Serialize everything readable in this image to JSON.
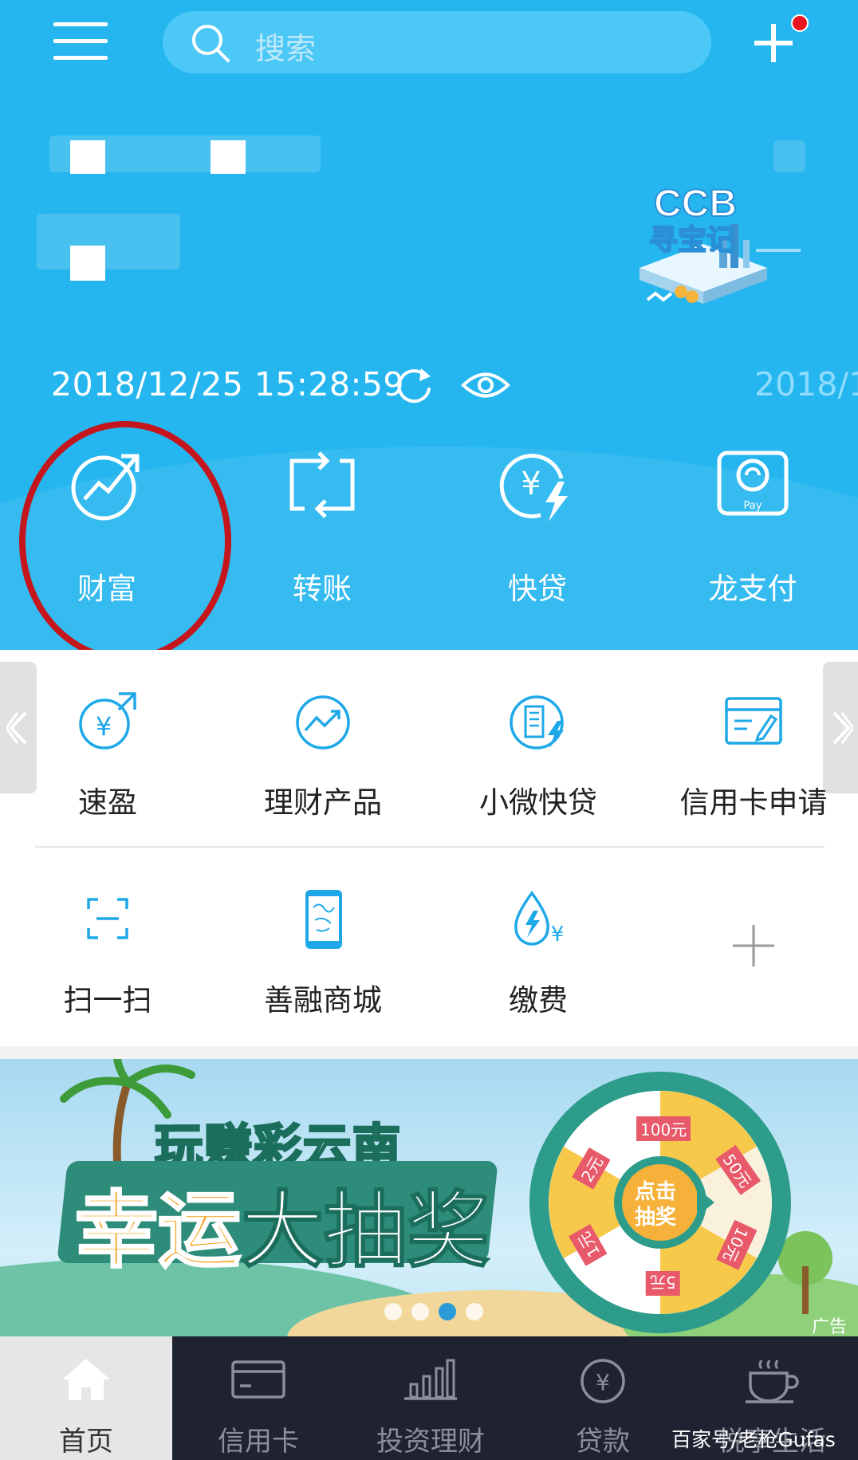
{
  "header": {
    "search_placeholder": "搜索",
    "datetime": "2018/12/25 15:28:59",
    "datetime_partial": "2018/1",
    "promo_logo_text": [
      "CCB",
      "寻宝记"
    ]
  },
  "quick_actions": [
    {
      "label": "财富",
      "icon": "wealth-icon"
    },
    {
      "label": "转账",
      "icon": "transfer-icon"
    },
    {
      "label": "快贷",
      "icon": "quick-loan-icon"
    },
    {
      "label": "龙支付",
      "icon": "long-pay-icon"
    }
  ],
  "services_row1": [
    {
      "label": "速盈",
      "icon": "suying-icon"
    },
    {
      "label": "理财产品",
      "icon": "finance-product-icon"
    },
    {
      "label": "小微快贷",
      "icon": "small-loan-icon"
    },
    {
      "label": "信用卡申请",
      "icon": "credit-card-apply-icon"
    }
  ],
  "services_row2": [
    {
      "label": "扫一扫",
      "icon": "scan-icon"
    },
    {
      "label": "善融商城",
      "icon": "mall-icon"
    },
    {
      "label": "缴费",
      "icon": "payment-icon"
    },
    {
      "label": "",
      "icon": "add-icon"
    }
  ],
  "banner": {
    "line1": "玩赚彩云南",
    "line2_a": "幸运",
    "line2_b": "大抽奖",
    "wheel_center": [
      "点击",
      "抽奖"
    ],
    "prizes": [
      "100元",
      "50元",
      "10元",
      "5元",
      "1元",
      "2元"
    ],
    "ad_tag": "广告",
    "page_count": 4,
    "active_page": 3
  },
  "bottom_nav": [
    {
      "label": "首页",
      "icon": "home-icon",
      "active": true
    },
    {
      "label": "信用卡",
      "icon": "credit-card-icon",
      "active": false
    },
    {
      "label": "投资理财",
      "icon": "investment-icon",
      "active": false
    },
    {
      "label": "贷款",
      "icon": "loan-icon",
      "active": false
    },
    {
      "label": "悦享生活",
      "icon": "coffee-icon",
      "active": false
    }
  ],
  "watermark": "百家号/老枪Gufas",
  "colors": {
    "header_bg": "#26b6ef",
    "icon_blue": "#1fa8e8",
    "highlight_circle": "#c4161c",
    "nav_bg": "#1f2230"
  }
}
